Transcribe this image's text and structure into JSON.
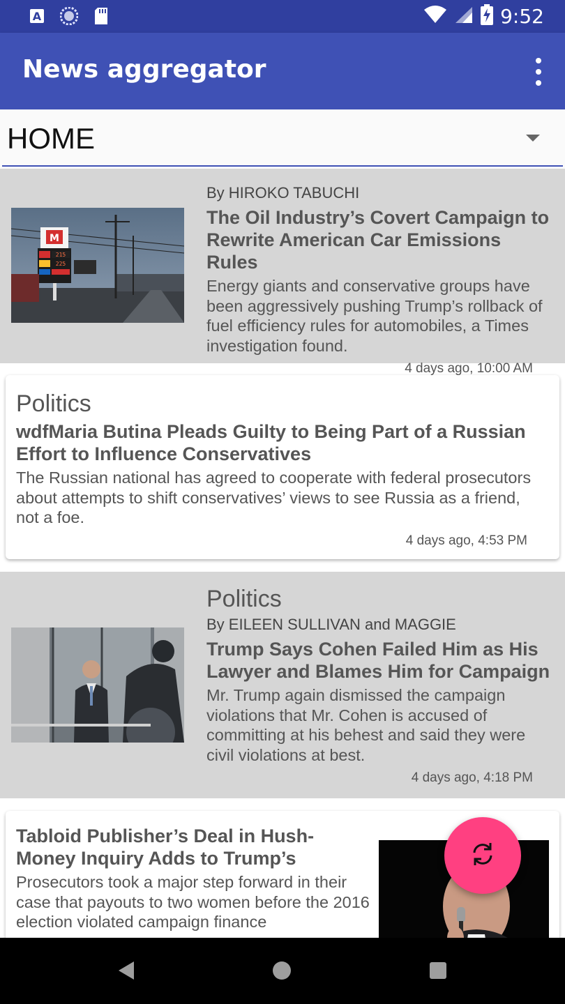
{
  "status_bar": {
    "time": "9:52",
    "icons": [
      "text-a-icon",
      "sync-circle-icon",
      "sd-card-icon",
      "wifi-icon",
      "signal-icon",
      "battery-charging-icon"
    ]
  },
  "app_bar": {
    "title": "News aggregator",
    "menu_icon": "overflow-menu-icon"
  },
  "section_spinner": {
    "selected": "HOME",
    "icon": "dropdown-arrow-icon"
  },
  "articles": [
    {
      "byline": "By HIROKO TABUCHI",
      "headline": "The Oil Industry’s Covert Campaign to Rewrite American Car Emissions Rules",
      "summary": "Energy giants and conservative groups have been aggressively pushing Trump’s rollback of fuel efficiency rules for automobiles, a Times investigation found.",
      "timestamp": "4 days ago, 10:00 AM",
      "image": "gas-station-photo"
    },
    {
      "section": "Politics",
      "headline": "wdfMaria Butina Pleads Guilty to Being Part of a Russian Effort to Influence Conservatives",
      "summary": "The Russian national has agreed to cooperate with federal prosecutors about attempts to shift conservatives’ views to see Russia as a friend, not a foe.",
      "timestamp": "4 days ago, 4:53 PM"
    },
    {
      "section": "Politics",
      "byline": "By EILEEN SULLIVAN and MAGGIE",
      "headline": "Trump Says Cohen Failed Him as His Lawyer and Blames Him for Campaign",
      "summary": "Mr. Trump again dismissed the campaign violations that Mr. Cohen is accused of committing at his behest and said they were civil violations at best.",
      "timestamp": "4 days ago, 4:18 PM",
      "image": "man-in-doorway-photo"
    },
    {
      "headline": "Tabloid Publisher’s Deal in Hush-Money Inquiry Adds to Trump’s",
      "summary": "Prosecutors took a major step forward in their case that payouts to two women before the 2016 election violated campaign finance",
      "image": "speaker-microphone-photo"
    }
  ],
  "fab": {
    "icon": "refresh-icon"
  },
  "nav_bar": {
    "icons": [
      "back-icon",
      "home-icon",
      "recents-icon"
    ]
  },
  "colors": {
    "status_bar": "#303f9f",
    "primary": "#3f51b5",
    "accent": "#ff4081",
    "gray_card": "#d6d6d6"
  }
}
